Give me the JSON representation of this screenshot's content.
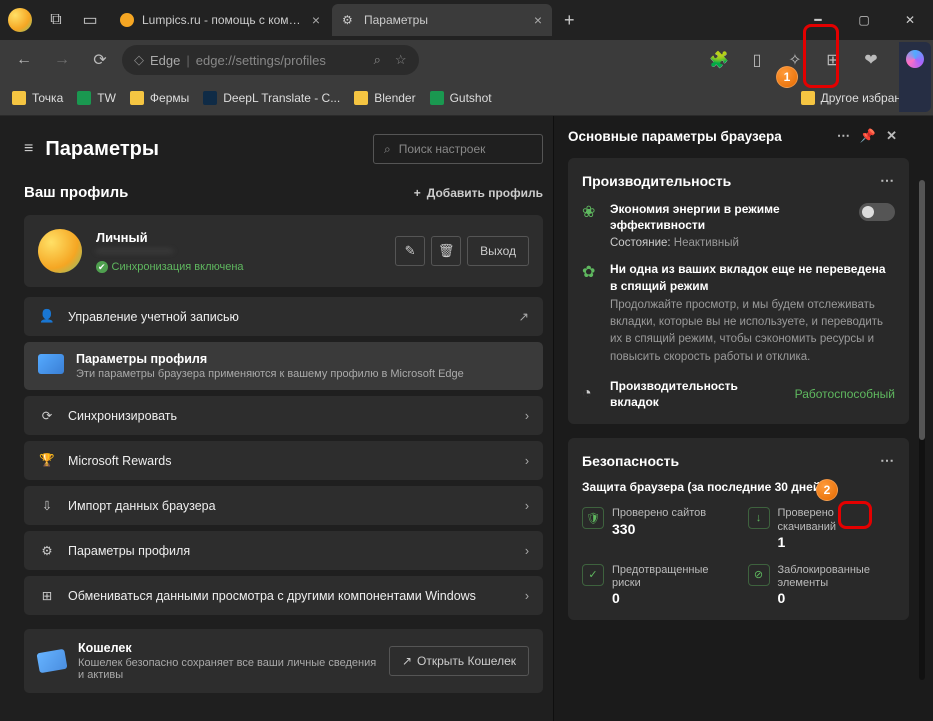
{
  "tabs": [
    {
      "title": "Lumpics.ru - помощь с компью..."
    },
    {
      "title": "Параметры"
    }
  ],
  "address": {
    "proto": "Edge",
    "url": "edge://settings/profiles"
  },
  "bookmarks": {
    "items": [
      "Точка",
      "TW",
      "Фермы",
      "DeepL Translate - С...",
      "Blender",
      "Gutshot"
    ],
    "other": "Другое избранное"
  },
  "settings": {
    "title": "Параметры",
    "search_placeholder": "Поиск настроек",
    "profile_section": "Ваш профиль",
    "add_profile": "Добавить профиль",
    "profile": {
      "name": "Личный",
      "email": "———————",
      "sync": "Синхронизация включена",
      "logout": "Выход"
    },
    "manage_account": "Управление учетной записью",
    "profile_params": {
      "title": "Параметры профиля",
      "desc": "Эти параметры браузера применяются к вашему профилю в Microsoft Edge"
    },
    "items": [
      "Синхронизировать",
      "Microsoft Rewards",
      "Импорт данных браузера",
      "Параметры профиля",
      "Обмениваться данными просмотра с другими компонентами Windows"
    ],
    "wallet": {
      "title": "Кошелек",
      "desc": "Кошелек безопасно сохраняет все ваши личные сведения и активы",
      "open": "Открыть Кошелек"
    }
  },
  "panel": {
    "title": "Основные параметры браузера",
    "perf": {
      "title": "Производительность",
      "energy_title": "Экономия энергии в режиме эффективности",
      "state_label": "Состояние:",
      "state_val": "Неактивный",
      "tabs_title": "Ни одна из ваших вкладок еще не переведена в спящий режим",
      "tabs_desc": "Продолжайте просмотр, и мы будем отслеживать вкладки, которые вы не используете, и переводить их в спящий режим, чтобы сэкономить ресурсы и повысить скорость работы и отклика.",
      "tab_perf": "Производительность вкладок",
      "tab_status": "Работоспособный"
    },
    "sec": {
      "title": "Безопасность",
      "subtitle": "Защита браузера (за последние 30 дней)",
      "sites_label": "Проверено сайтов",
      "sites_val": "330",
      "downloads_label": "Проверено скачиваний",
      "downloads_val": "1",
      "risks_label": "Предотвращенные риски",
      "risks_val": "0",
      "blocked_label": "Заблокированные элементы",
      "blocked_val": "0"
    }
  },
  "annot": {
    "n1": "1",
    "n2": "2"
  }
}
